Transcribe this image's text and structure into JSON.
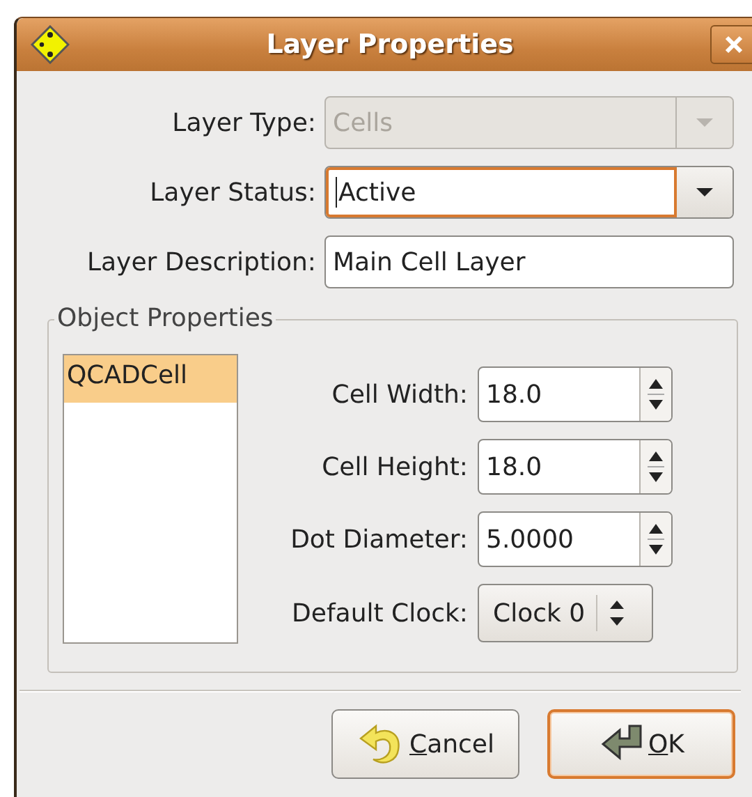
{
  "window": {
    "title": "Layer Properties"
  },
  "fields": [
    {
      "kind": "combo",
      "label": "Layer Type:",
      "value": "Cells",
      "disabled": true,
      "focused": false
    },
    {
      "kind": "combo",
      "label": "Layer Status:",
      "value": "Active",
      "disabled": false,
      "focused": true
    },
    {
      "kind": "entry",
      "label": "Layer Description:",
      "value": "Main Cell Layer",
      "disabled": false,
      "focused": false
    }
  ],
  "object_properties": {
    "title": "Object Properties",
    "objects": [
      {
        "label": "QCADCell",
        "selected": true
      }
    ],
    "properties": [
      {
        "kind": "spin",
        "label": "Cell Width:",
        "value": "18.0"
      },
      {
        "kind": "spin",
        "label": "Cell Height:",
        "value": "18.0"
      },
      {
        "kind": "spin",
        "label": "Dot Diameter:",
        "value": "5.0000"
      },
      {
        "kind": "option",
        "label": "Default Clock:",
        "value": "Clock 0"
      }
    ]
  },
  "buttons": [
    {
      "kind": "cancel",
      "label": "Cancel",
      "mnemonic_underlined": true,
      "default": false
    },
    {
      "kind": "ok",
      "label": "OK",
      "mnemonic_underlined": true,
      "default": true
    }
  ]
}
